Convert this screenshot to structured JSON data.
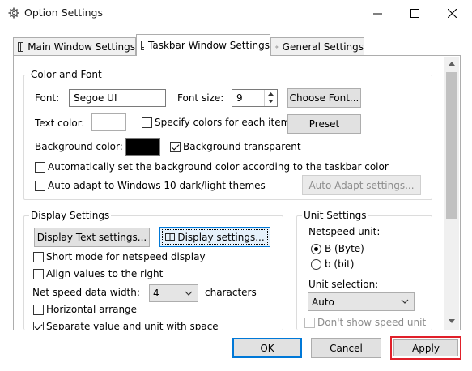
{
  "window": {
    "title": "Option Settings",
    "minimize_icon": "minimize-icon",
    "maximize_icon": "maximize-icon",
    "close_icon": "close-icon"
  },
  "tabs": [
    {
      "label": "Main Window Settings",
      "icon": "window-icon",
      "active": false
    },
    {
      "label": "Taskbar Window Settings",
      "icon": "taskbar-icon",
      "active": true
    },
    {
      "label": "General Settings",
      "icon": "gear-icon",
      "active": false
    }
  ],
  "color_font": {
    "legend": "Color and Font",
    "font_label": "Font:",
    "font_value": "Segoe UI",
    "font_size_label": "Font size:",
    "font_size_value": "9",
    "choose_font_button": "Choose Font...",
    "text_color_label": "Text color:",
    "specify_colors_label": "Specify colors for each item",
    "specify_colors_checked": false,
    "preset_button": "Preset",
    "background_color_label": "Background color:",
    "background_color": "#000000",
    "text_color": "#ffffff",
    "background_transparent_label": "Background transparent",
    "background_transparent_checked": true,
    "auto_bg_label": "Automatically set the background color according to the taskbar color",
    "auto_bg_checked": false,
    "auto_adapt_label": "Auto adapt to Windows 10 dark/light themes",
    "auto_adapt_checked": false,
    "auto_adapt_settings_button": "Auto Adapt settings..."
  },
  "display": {
    "legend": "Display Settings",
    "display_text_settings_button": "Display Text settings...",
    "display_settings_button": "Display settings...",
    "short_mode_label": "Short mode for netspeed display",
    "short_mode_checked": false,
    "align_right_label": "Align values to the right",
    "align_right_checked": false,
    "data_width_label": "Net speed data width:",
    "data_width_value": "4",
    "characters_label": "characters",
    "horizontal_label": "Horizontal arrange",
    "horizontal_checked": false,
    "separate_label": "Separate value and unit with space",
    "separate_checked": true
  },
  "unit": {
    "legend": "Unit Settings",
    "netspeed_unit_label": "Netspeed unit:",
    "byte_label": "B (Byte)",
    "byte_checked": true,
    "bit_label": "b (bit)",
    "bit_checked": false,
    "unit_selection_label": "Unit selection:",
    "unit_selection_value": "Auto",
    "dont_show_label": "Don't show speed unit",
    "dont_show_checked": false
  },
  "footer": {
    "ok": "OK",
    "cancel": "Cancel",
    "apply": "Apply",
    "apply_highlight_color": "#e0202a",
    "default_button_color": "#0078d7"
  }
}
